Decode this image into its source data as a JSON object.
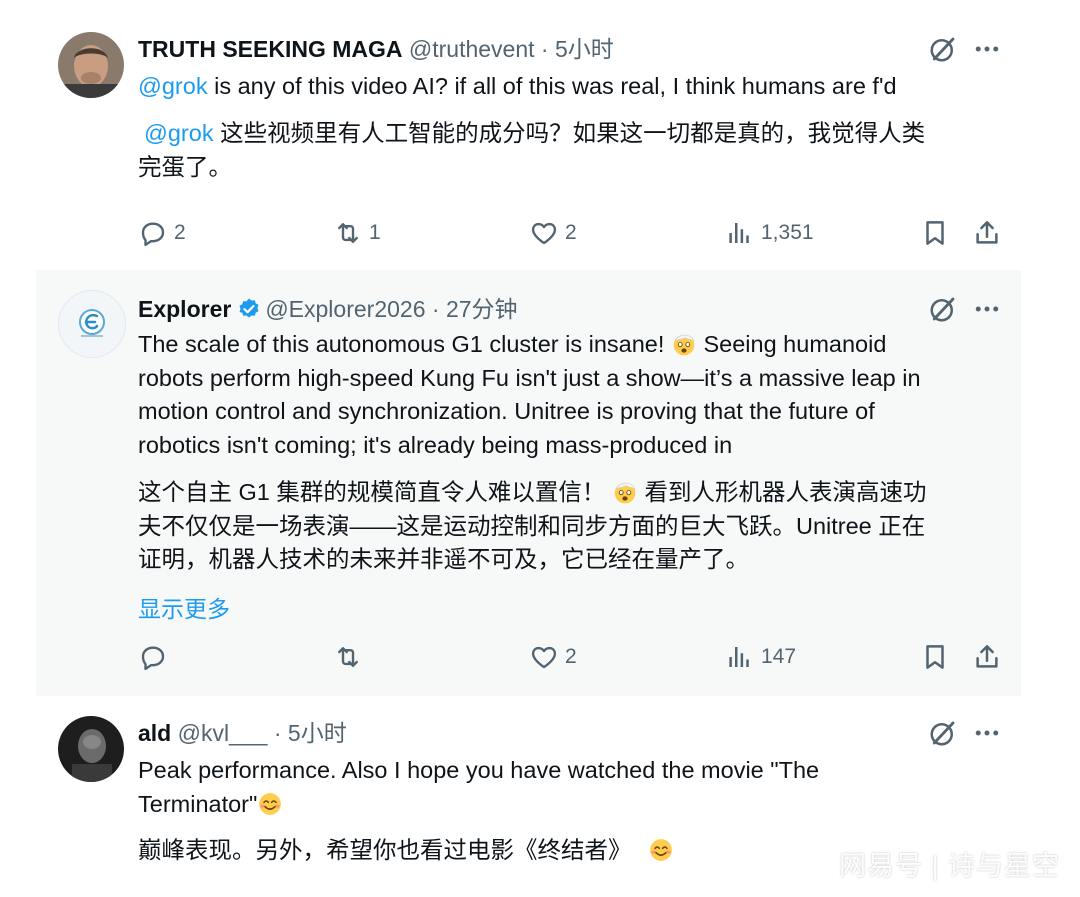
{
  "tweets": [
    {
      "name": "TRUTH SEEKING MAGA",
      "handle": "@truthevent",
      "separator": "·",
      "time": "5小时",
      "mention": "@grok",
      "text_en": " is any of this video AI? if all of this was real, I think humans are f'd",
      "mention_zh": "@grok",
      "text_zh_line1": " 这些视频里有人工智能的成分吗？如果这一切都是真的，我觉得人类",
      "text_zh_line2": "完蛋了。",
      "replies": "2",
      "retweets": "1",
      "likes": "2",
      "views": "1,351"
    },
    {
      "name": "Explorer",
      "handle": "@Explorer2026",
      "separator": "·",
      "time": "27分钟",
      "verified": true,
      "text_en_lines": [
        "The scale of this autonomous G1 cluster is insane!",
        " Seeing humanoid",
        "robots perform high-speed Kung Fu isn't just a show—it’s a massive leap in",
        "motion control and synchronization. Unitree is proving that the future of",
        "robotics isn't coming; it's already being mass-produced in"
      ],
      "text_zh_lines": [
        "这个自主 G1 集群的规模简直令人难以置信！",
        " 看到人形机器人表演高速功",
        "夫不仅仅是一场表演——这是运动控制和同步方面的巨大飞跃。Unitree 正在",
        "证明，机器人技术的未来并非遥不可及，它已经在量产了。"
      ],
      "show_more": "显示更多",
      "likes": "2",
      "views": "147"
    },
    {
      "name": "ald",
      "handle": "@kvl___",
      "separator": "·",
      "time": "5小时",
      "text_en_line1": "Peak performance. Also I hope you have watched the movie \"The",
      "text_en_line2": "Terminator\"",
      "text_zh": "巅峰表现。另外，希望你也看过电影《终结者》"
    }
  ],
  "watermark": "网易号 | 诗与星空",
  "colors": {
    "accent": "#1d9bf0",
    "muted": "#536471",
    "verified": "#1d9bf0",
    "highlight_bg": "#f7f9f9"
  }
}
